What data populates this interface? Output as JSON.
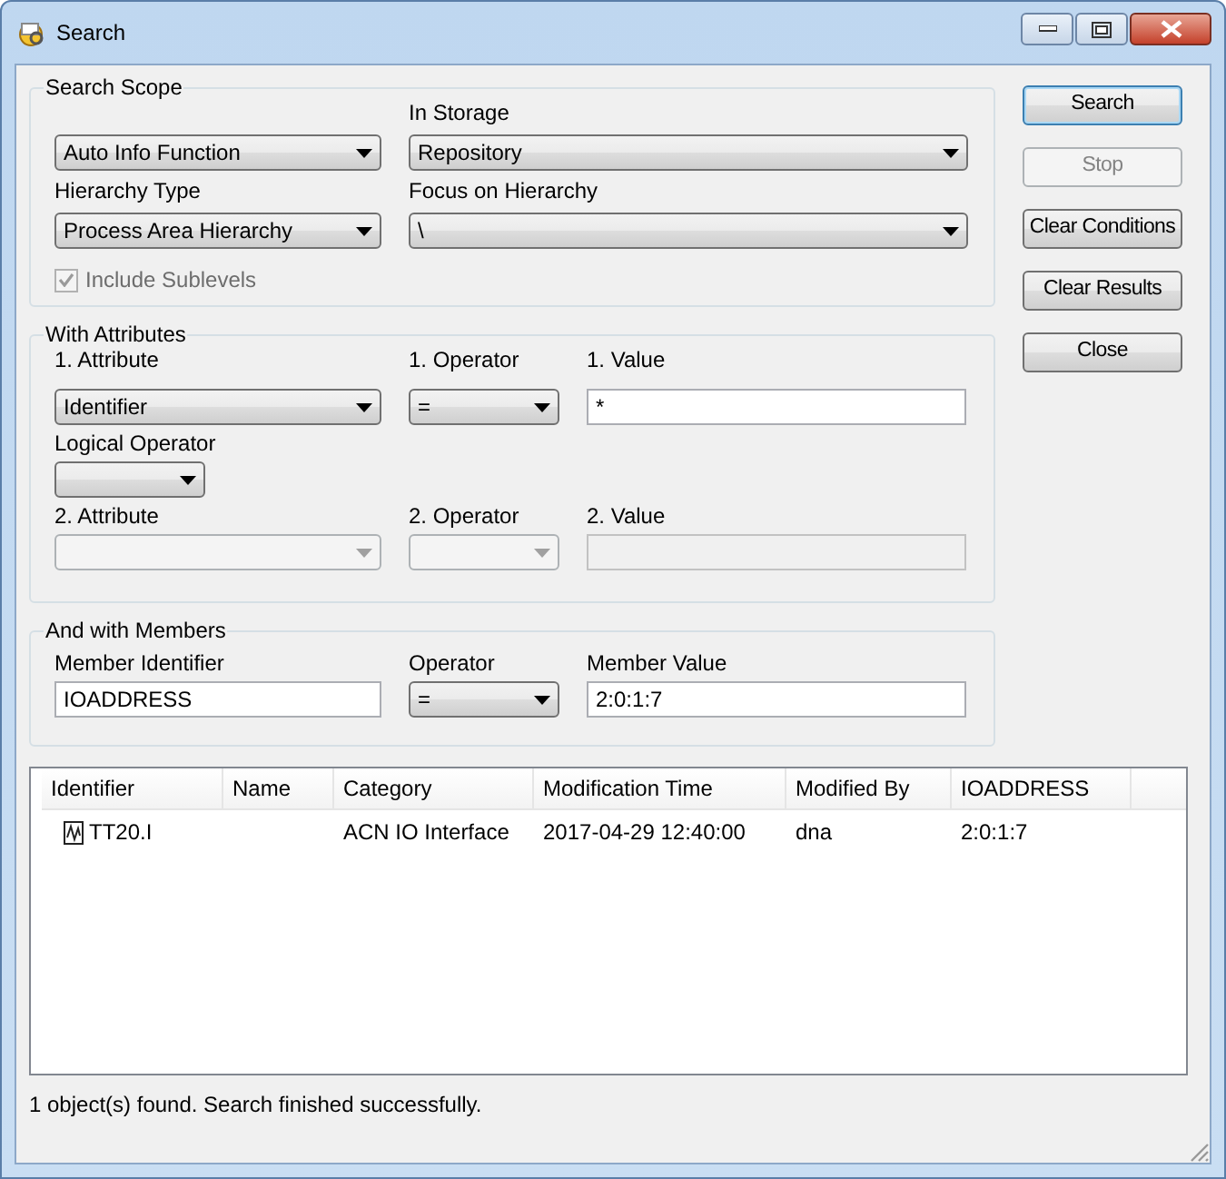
{
  "window": {
    "title": "Search"
  },
  "search_scope": {
    "title": "Search Scope",
    "fields": [
      {
        "kind": "dropdown",
        "value": "Auto Info Function",
        "disabled": false
      },
      {
        "kind": "dropdown",
        "label": "Hierarchy Type",
        "value": "Process Area Hierarchy",
        "disabled": false
      },
      {
        "kind": "dropdown",
        "label": "In Storage",
        "value": "Repository",
        "disabled": false
      },
      {
        "kind": "dropdown",
        "label": "Focus on Hierarchy",
        "value": "\\",
        "disabled": false
      }
    ],
    "include_sublevels": {
      "label": "Include Sublevels",
      "checked": true,
      "disabled": true
    }
  },
  "with_attributes": {
    "title": "With Attributes",
    "fields": [
      {
        "kind": "dropdown",
        "label": "1. Attribute",
        "value": "Identifier",
        "disabled": false
      },
      {
        "kind": "dropdown",
        "label": "1. Operator",
        "value": "=",
        "disabled": false
      },
      {
        "kind": "text",
        "label": "1. Value",
        "value": "*",
        "disabled": false
      },
      {
        "kind": "dropdown",
        "label": "Logical Operator",
        "disabled": false
      },
      {
        "kind": "dropdown",
        "label": "2. Attribute",
        "disabled": true
      },
      {
        "kind": "dropdown",
        "label": "2. Operator",
        "disabled": true
      },
      {
        "kind": "text",
        "label": "2. Value",
        "disabled": true
      }
    ]
  },
  "and_with_members": {
    "title": "And with Members",
    "fields": [
      {
        "kind": "text",
        "label": "Member Identifier",
        "value": "IOADDRESS",
        "disabled": false
      },
      {
        "kind": "dropdown",
        "label": "Operator",
        "value": "=",
        "disabled": false
      },
      {
        "kind": "text",
        "label": "Member Value",
        "value": "2:0:1:7",
        "disabled": false
      }
    ]
  },
  "buttons": [
    {
      "label": "Search",
      "default": true,
      "disabled": false
    },
    {
      "label": "Stop",
      "default": false,
      "disabled": true
    },
    {
      "label": "Clear Conditions",
      "default": false,
      "disabled": false
    },
    {
      "label": "Clear Results",
      "default": false,
      "disabled": false
    },
    {
      "label": "Close",
      "default": false,
      "disabled": false
    }
  ],
  "results": {
    "columns": [
      "Identifier",
      "Name",
      "Category",
      "Modification Time",
      "Modified By",
      "IOADDRESS"
    ],
    "rows": [
      {
        "cells": [
          "TT20.I",
          null,
          "ACN IO Interface",
          "2017-04-29 12:40:00",
          "dna",
          "2:0:1:7"
        ],
        "selected": false
      }
    ]
  },
  "status_bar": "1 object(s) found. Search finished successfully."
}
